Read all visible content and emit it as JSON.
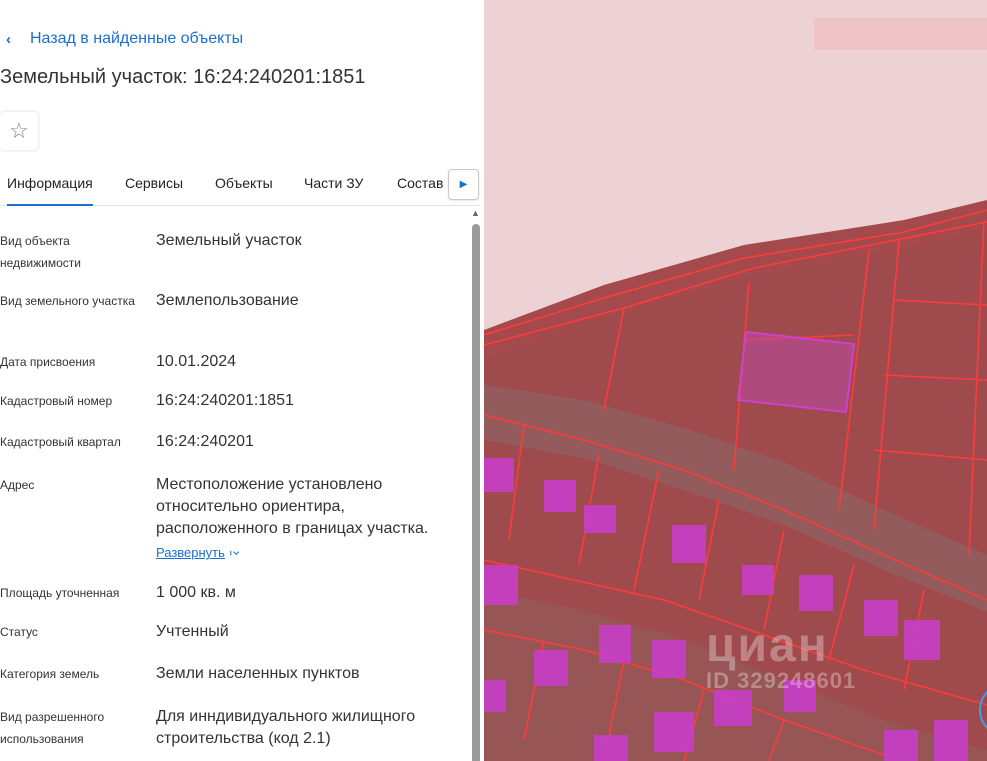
{
  "back_link": {
    "label": "Назад в найденные объекты",
    "icon": "chevron-left-icon"
  },
  "page_title": "Земельный участок: 16:24:240201:1851",
  "favorite": {
    "icon": "star-outline-icon"
  },
  "tabs": [
    {
      "label": "Информация",
      "active": true
    },
    {
      "label": "Сервисы",
      "active": false
    },
    {
      "label": "Объекты",
      "active": false
    },
    {
      "label": "Части ЗУ",
      "active": false
    },
    {
      "label": "Состав",
      "active": false
    }
  ],
  "tab_next": {
    "icon": "caret-right-icon"
  },
  "fields": [
    {
      "label": "Вид объекта недвижимости",
      "value": "Земельный участок"
    },
    {
      "label": "Вид земельного участка",
      "value": "Землепользование"
    },
    {
      "label": "Дата присвоения",
      "value": "10.01.2024"
    },
    {
      "label": "Кадастровый номер",
      "value": "16:24:240201:1851"
    },
    {
      "label": "Кадастровый квартал",
      "value": "16:24:240201"
    },
    {
      "label": "Адрес",
      "value": "Местоположение установлено относительно ориентира, расположенного в границах участка.",
      "expand": "Развернуть"
    },
    {
      "label": "Площадь уточненная",
      "value": "1 000 кв. м"
    },
    {
      "label": "Статус",
      "value": "Учтенный"
    },
    {
      "label": "Категория земель",
      "value": "Земли населенных пунктов"
    },
    {
      "label": "Вид разрешенного использования",
      "value": "Для инндивидуального жилищного строительства (код 2.1)"
    }
  ],
  "map": {
    "watermark": "циан",
    "watermark_id": "ID 329248601",
    "colors": {
      "overlay": "#a84848",
      "boundary": "#ff3030",
      "selected": "#d040d0",
      "roof": "#c840c8",
      "accent": "#1a6fd1"
    }
  }
}
